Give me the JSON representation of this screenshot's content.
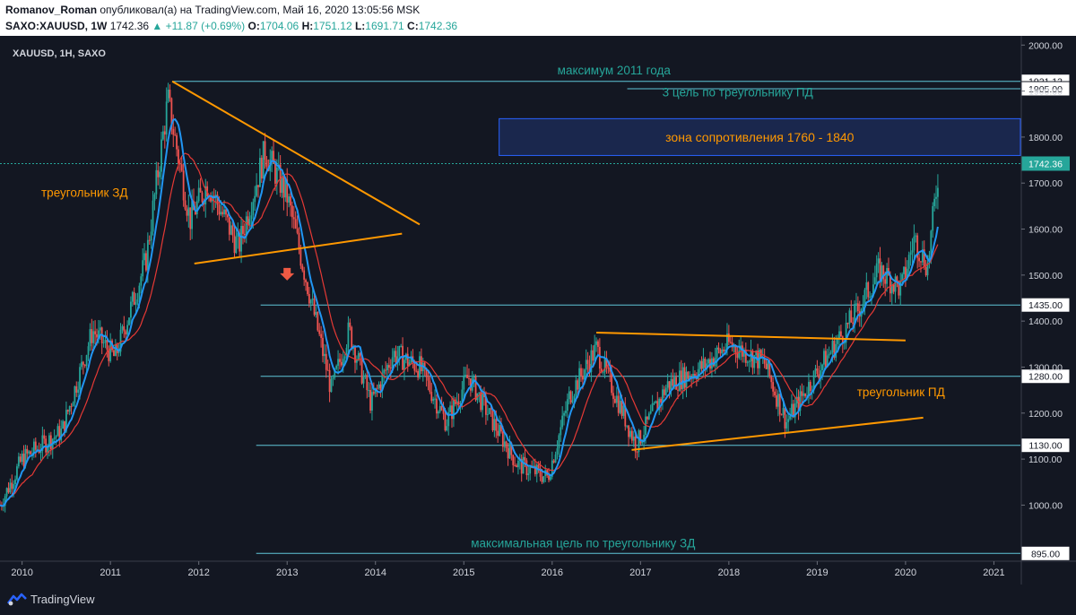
{
  "header": {
    "author": "Romanov_Roman",
    "published": "опубликовал(а) на TradingView.com, Май 16, 2020 13:05:56 MSK",
    "symbol": "SAXO:XAUUSD, 1W",
    "last": "1742.36",
    "change": "▲ +11.87 (+0.69%)",
    "o_label": "O:",
    "o_value": "1704.06",
    "h_label": "H:",
    "h_value": "1751.12",
    "l_label": "L:",
    "l_value": "1691.71",
    "c_label": "C:",
    "c_value": "1742.36"
  },
  "footer": {
    "logo_text": "TradingView",
    "logo_icon": "tradingview-logo-icon"
  },
  "colors": {
    "background": "#131722",
    "up": "#26a69a",
    "down": "#ef5350",
    "ma_fast": "#2196f3",
    "ma_slow": "#e53935",
    "level": "#5fc6d8",
    "trend": "#ff9800",
    "zone_fill": "#1c2a55",
    "zone_border": "#2962ff",
    "teal_text": "#26a69a"
  },
  "chart_data": {
    "type": "candlestick",
    "title": "XAUUSD, 1H, SAXO",
    "x_tick_labels": [
      "2010",
      "2011",
      "2012",
      "2013",
      "2014",
      "2015",
      "2016",
      "2017",
      "2018",
      "2019",
      "2020",
      "2021"
    ],
    "x_range": [
      2009.75,
      2021.3
    ],
    "y_tick_labels": [
      "1000.00",
      "1100.00",
      "1200.00",
      "1300.00",
      "1400.00",
      "1500.00",
      "1600.00",
      "1700.00",
      "1800.00",
      "1900.00",
      "2000.00"
    ],
    "y_range": [
      880,
      2020
    ],
    "price_path": [
      [
        2009.75,
        1000
      ],
      [
        2010.0,
        1100
      ],
      [
        2010.45,
        1160
      ],
      [
        2010.8,
        1380
      ],
      [
        2011.05,
        1320
      ],
      [
        2011.4,
        1530
      ],
      [
        2011.65,
        1880
      ],
      [
        2011.9,
        1620
      ],
      [
        2012.1,
        1700
      ],
      [
        2012.45,
        1560
      ],
      [
        2012.75,
        1770
      ],
      [
        2013.0,
        1670
      ],
      [
        2013.3,
        1420
      ],
      [
        2013.5,
        1250
      ],
      [
        2013.7,
        1380
      ],
      [
        2013.95,
        1220
      ],
      [
        2014.2,
        1330
      ],
      [
        2014.5,
        1300
      ],
      [
        2014.8,
        1180
      ],
      [
        2015.05,
        1280
      ],
      [
        2015.3,
        1190
      ],
      [
        2015.6,
        1090
      ],
      [
        2015.95,
        1060
      ],
      [
        2016.2,
        1240
      ],
      [
        2016.5,
        1340
      ],
      [
        2016.95,
        1130
      ],
      [
        2017.3,
        1260
      ],
      [
        2017.7,
        1300
      ],
      [
        2018.0,
        1350
      ],
      [
        2018.4,
        1310
      ],
      [
        2018.65,
        1180
      ],
      [
        2019.0,
        1290
      ],
      [
        2019.45,
        1420
      ],
      [
        2019.7,
        1510
      ],
      [
        2019.95,
        1470
      ],
      [
        2020.1,
        1580
      ],
      [
        2020.25,
        1520
      ],
      [
        2020.38,
        1742
      ]
    ],
    "moving_averages": [
      "fast (blue)",
      "slow (red)"
    ],
    "last_price": 1742.36,
    "levels": [
      {
        "value": 1921.13,
        "label": "1921.13"
      },
      {
        "value": 1905.0,
        "label": "1905.00"
      },
      {
        "value": 1435.0,
        "label": "1435.00"
      },
      {
        "value": 1280.0,
        "label": "1280.00"
      },
      {
        "value": 1130.0,
        "label": "1130.00"
      },
      {
        "value": 895.0,
        "label": "895.00"
      }
    ],
    "resistance_zone": {
      "from": 1760,
      "to": 1840,
      "label": "зона сопротивления 1760 - 1840"
    },
    "annotations": [
      {
        "text": "максимум 2011 года"
      },
      {
        "text": "3 цель по треугольнику ПД"
      },
      {
        "text": "треугольник ЗД"
      },
      {
        "text": "треугольник ПД"
      },
      {
        "text": "максимальная цель по треугольнику ЗД"
      }
    ],
    "trendlines": [
      {
        "name": "triangle-zd-upper",
        "points": [
          [
            2011.7,
            1921
          ],
          [
            2014.5,
            1610
          ]
        ]
      },
      {
        "name": "triangle-zd-lower",
        "points": [
          [
            2011.95,
            1525
          ],
          [
            2014.3,
            1590
          ]
        ]
      },
      {
        "name": "triangle-pd-upper",
        "points": [
          [
            2016.5,
            1375
          ],
          [
            2020.0,
            1358
          ]
        ]
      },
      {
        "name": "triangle-pd-lower",
        "points": [
          [
            2016.9,
            1120
          ],
          [
            2020.2,
            1190
          ]
        ]
      }
    ]
  }
}
